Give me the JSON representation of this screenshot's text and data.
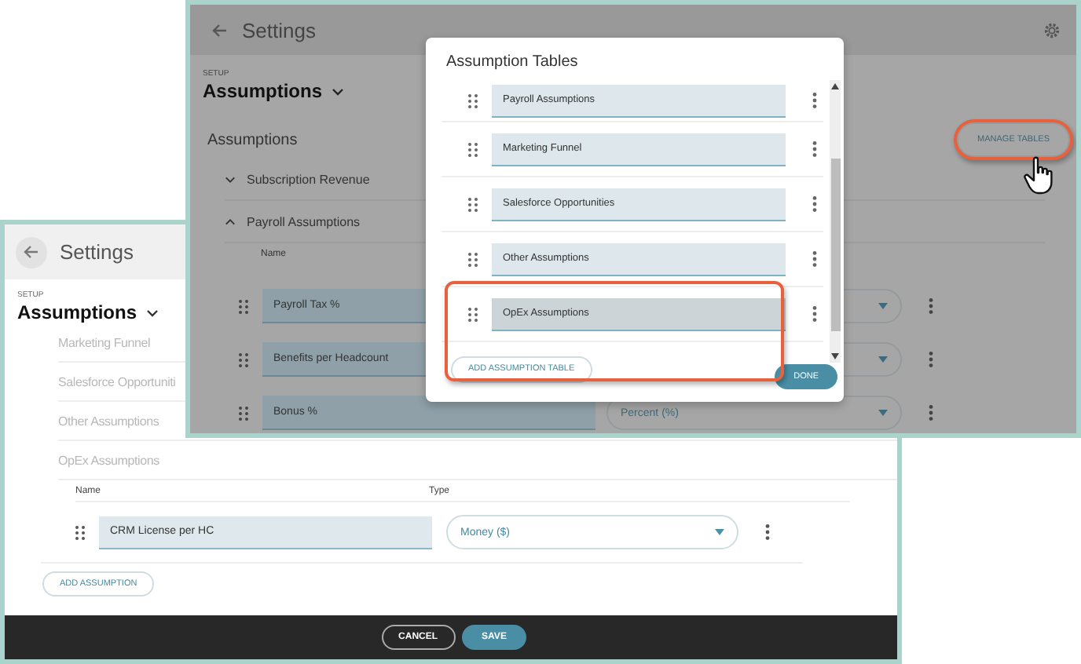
{
  "back_window": {
    "title": "Settings",
    "section_label": "SETUP",
    "page_title": "Assumptions",
    "tables": [
      {
        "name": "Marketing Funnel"
      },
      {
        "name": "Salesforce Opportuniti"
      },
      {
        "name": "Other Assumptions"
      },
      {
        "name": "OpEx Assumptions"
      }
    ],
    "columns": [
      "Name",
      "Type"
    ],
    "rows": [
      {
        "name": "CRM License per HC",
        "type": "Money ($)"
      }
    ],
    "add_button": "ADD ASSUMPTION",
    "footer_buttons": [
      {
        "label": "CANCEL",
        "kind": "secondary"
      },
      {
        "label": "SAVE",
        "kind": "primary"
      }
    ]
  },
  "front_window": {
    "title": "Settings",
    "section_label": "SETUP",
    "page_title": "Assumptions",
    "panel_title": "Assumptions",
    "manage_button": {
      "label": "MANAGE TABLES",
      "highlighted": true
    },
    "groups": [
      {
        "name": "Subscription Revenue",
        "expanded": false
      },
      {
        "name": "Payroll Assumptions",
        "expanded": true
      }
    ],
    "column": "Name",
    "rows": [
      {
        "name": "Payroll Tax %"
      },
      {
        "name": "Benefits per Headcount"
      },
      {
        "name": "Bonus %",
        "type": "Percent (%)"
      }
    ],
    "dialog": {
      "title": "Assumption Tables",
      "tables": [
        {
          "name": "Payroll Assumptions",
          "editing": false
        },
        {
          "name": "Marketing Funnel",
          "editing": false
        },
        {
          "name": "Salesforce Opportunities",
          "editing": false
        },
        {
          "name": "Other Assumptions",
          "editing": false
        },
        {
          "name": "OpEx Assumptions",
          "editing": true
        }
      ],
      "add_button": "ADD ASSUMPTION TABLE",
      "new_table_highlighted": true,
      "done_button": "DONE"
    }
  }
}
